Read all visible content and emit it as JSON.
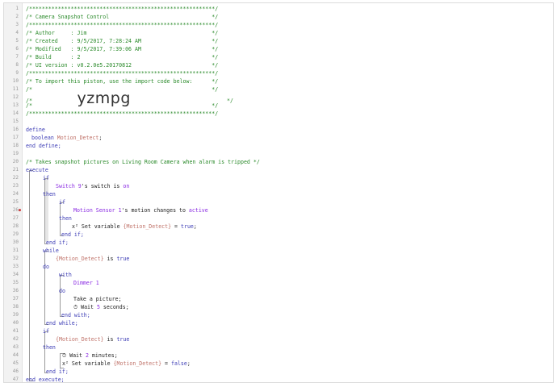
{
  "header_comments": [
    "/**********************************************************/",
    "/* Camera Snapshot Control                                */",
    "/**********************************************************/",
    "/* Author     : Jim                                       */",
    "/* Created    : 9/5/2017, 7:28:24 AM                      */",
    "/* Modified   : 9/5/2017, 7:39:06 AM                      */",
    "/* Build      : 2                                         */",
    "/* UI version : v0.2.0e5.20170812                         */",
    "/**********************************************************/",
    "/* To import this piston, use the import code below:      */",
    "/*                                                        */"
  ],
  "import_line_prefix": "/*              ",
  "import_code": "yzmpg",
  "import_line_suffix": "                              */",
  "comment_blank": "/*                                                        */",
  "comment_border": "/**********************************************************/",
  "define_kw": "define",
  "bool_type": "boolean",
  "var_name": "Motion_Detect",
  "semicolon": ";",
  "end_define": "end define;",
  "takes_comment": "/* Takes snapshot pictures on Living Room Camera when alarm is tripped */",
  "execute_kw": "execute",
  "if_kw": "if",
  "switch_device": "Switch 9",
  "switch_text": "'s switch is ",
  "on_val": "on",
  "then_kw": "then",
  "motion_device": "Motion Sensor 1",
  "motion_text": "'s motion changes to ",
  "active_val": "active",
  "set_var_prefix": "x² Set variable ",
  "var_ref": "{Motion_Detect}",
  "eq_text": " = ",
  "true_val": "true",
  "false_val": "false",
  "end_if": "end if;",
  "while_kw": "while",
  "is_text": " is ",
  "do_kw": "do",
  "with_kw": "with",
  "dimmer_device": "Dimmer 1",
  "take_picture": "Take a picture;",
  "wait_prefix": "⏱ Wait ",
  "five_val": "5",
  "seconds_text": " seconds;",
  "end_with": "end with;",
  "end_while": "end while;",
  "two_val": "2",
  "minutes_text": " minutes;",
  "end_execute": "end execute;",
  "line_numbers": [
    "1",
    "2",
    "3",
    "4",
    "5",
    "6",
    "7",
    "8",
    "9",
    "10",
    "11",
    "12",
    "13",
    "14",
    "15",
    "16",
    "17",
    "18",
    "19",
    "20",
    "21",
    "22",
    "23",
    "24",
    "25",
    "26",
    "27",
    "28",
    "29",
    "30",
    "31",
    "32",
    "33",
    "34",
    "35",
    "36",
    "37",
    "38",
    "39",
    "40",
    "41",
    "42",
    "43",
    "44",
    "45",
    "46",
    "47"
  ],
  "breakpoint_line": "26"
}
